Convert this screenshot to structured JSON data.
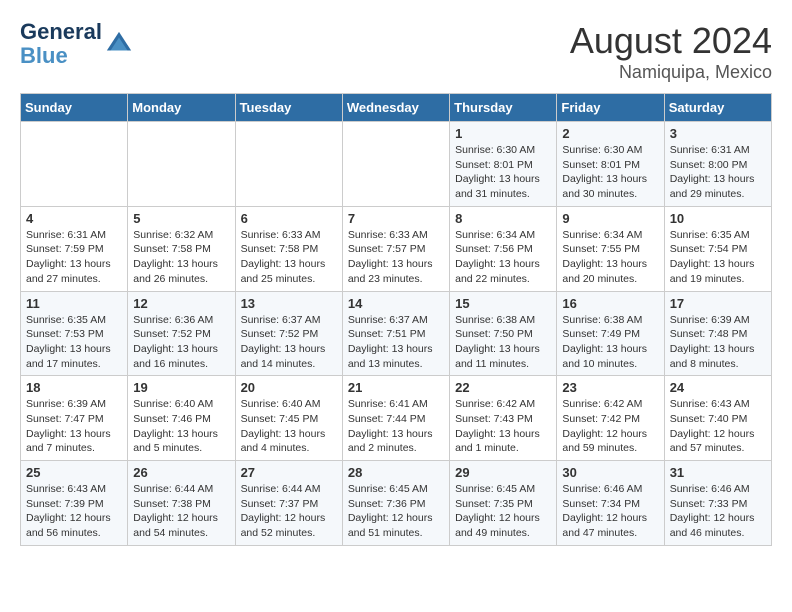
{
  "header": {
    "logo_line1": "General",
    "logo_line2": "Blue",
    "main_title": "August 2024",
    "subtitle": "Namiquipa, Mexico"
  },
  "days_of_week": [
    "Sunday",
    "Monday",
    "Tuesday",
    "Wednesday",
    "Thursday",
    "Friday",
    "Saturday"
  ],
  "weeks": [
    [
      {
        "day": "",
        "info": ""
      },
      {
        "day": "",
        "info": ""
      },
      {
        "day": "",
        "info": ""
      },
      {
        "day": "",
        "info": ""
      },
      {
        "day": "1",
        "info": "Sunrise: 6:30 AM\nSunset: 8:01 PM\nDaylight: 13 hours\nand 31 minutes."
      },
      {
        "day": "2",
        "info": "Sunrise: 6:30 AM\nSunset: 8:01 PM\nDaylight: 13 hours\nand 30 minutes."
      },
      {
        "day": "3",
        "info": "Sunrise: 6:31 AM\nSunset: 8:00 PM\nDaylight: 13 hours\nand 29 minutes."
      }
    ],
    [
      {
        "day": "4",
        "info": "Sunrise: 6:31 AM\nSunset: 7:59 PM\nDaylight: 13 hours\nand 27 minutes."
      },
      {
        "day": "5",
        "info": "Sunrise: 6:32 AM\nSunset: 7:58 PM\nDaylight: 13 hours\nand 26 minutes."
      },
      {
        "day": "6",
        "info": "Sunrise: 6:33 AM\nSunset: 7:58 PM\nDaylight: 13 hours\nand 25 minutes."
      },
      {
        "day": "7",
        "info": "Sunrise: 6:33 AM\nSunset: 7:57 PM\nDaylight: 13 hours\nand 23 minutes."
      },
      {
        "day": "8",
        "info": "Sunrise: 6:34 AM\nSunset: 7:56 PM\nDaylight: 13 hours\nand 22 minutes."
      },
      {
        "day": "9",
        "info": "Sunrise: 6:34 AM\nSunset: 7:55 PM\nDaylight: 13 hours\nand 20 minutes."
      },
      {
        "day": "10",
        "info": "Sunrise: 6:35 AM\nSunset: 7:54 PM\nDaylight: 13 hours\nand 19 minutes."
      }
    ],
    [
      {
        "day": "11",
        "info": "Sunrise: 6:35 AM\nSunset: 7:53 PM\nDaylight: 13 hours\nand 17 minutes."
      },
      {
        "day": "12",
        "info": "Sunrise: 6:36 AM\nSunset: 7:52 PM\nDaylight: 13 hours\nand 16 minutes."
      },
      {
        "day": "13",
        "info": "Sunrise: 6:37 AM\nSunset: 7:52 PM\nDaylight: 13 hours\nand 14 minutes."
      },
      {
        "day": "14",
        "info": "Sunrise: 6:37 AM\nSunset: 7:51 PM\nDaylight: 13 hours\nand 13 minutes."
      },
      {
        "day": "15",
        "info": "Sunrise: 6:38 AM\nSunset: 7:50 PM\nDaylight: 13 hours\nand 11 minutes."
      },
      {
        "day": "16",
        "info": "Sunrise: 6:38 AM\nSunset: 7:49 PM\nDaylight: 13 hours\nand 10 minutes."
      },
      {
        "day": "17",
        "info": "Sunrise: 6:39 AM\nSunset: 7:48 PM\nDaylight: 13 hours\nand 8 minutes."
      }
    ],
    [
      {
        "day": "18",
        "info": "Sunrise: 6:39 AM\nSunset: 7:47 PM\nDaylight: 13 hours\nand 7 minutes."
      },
      {
        "day": "19",
        "info": "Sunrise: 6:40 AM\nSunset: 7:46 PM\nDaylight: 13 hours\nand 5 minutes."
      },
      {
        "day": "20",
        "info": "Sunrise: 6:40 AM\nSunset: 7:45 PM\nDaylight: 13 hours\nand 4 minutes."
      },
      {
        "day": "21",
        "info": "Sunrise: 6:41 AM\nSunset: 7:44 PM\nDaylight: 13 hours\nand 2 minutes."
      },
      {
        "day": "22",
        "info": "Sunrise: 6:42 AM\nSunset: 7:43 PM\nDaylight: 13 hours\nand 1 minute."
      },
      {
        "day": "23",
        "info": "Sunrise: 6:42 AM\nSunset: 7:42 PM\nDaylight: 12 hours\nand 59 minutes."
      },
      {
        "day": "24",
        "info": "Sunrise: 6:43 AM\nSunset: 7:40 PM\nDaylight: 12 hours\nand 57 minutes."
      }
    ],
    [
      {
        "day": "25",
        "info": "Sunrise: 6:43 AM\nSunset: 7:39 PM\nDaylight: 12 hours\nand 56 minutes."
      },
      {
        "day": "26",
        "info": "Sunrise: 6:44 AM\nSunset: 7:38 PM\nDaylight: 12 hours\nand 54 minutes."
      },
      {
        "day": "27",
        "info": "Sunrise: 6:44 AM\nSunset: 7:37 PM\nDaylight: 12 hours\nand 52 minutes."
      },
      {
        "day": "28",
        "info": "Sunrise: 6:45 AM\nSunset: 7:36 PM\nDaylight: 12 hours\nand 51 minutes."
      },
      {
        "day": "29",
        "info": "Sunrise: 6:45 AM\nSunset: 7:35 PM\nDaylight: 12 hours\nand 49 minutes."
      },
      {
        "day": "30",
        "info": "Sunrise: 6:46 AM\nSunset: 7:34 PM\nDaylight: 12 hours\nand 47 minutes."
      },
      {
        "day": "31",
        "info": "Sunrise: 6:46 AM\nSunset: 7:33 PM\nDaylight: 12 hours\nand 46 minutes."
      }
    ]
  ]
}
